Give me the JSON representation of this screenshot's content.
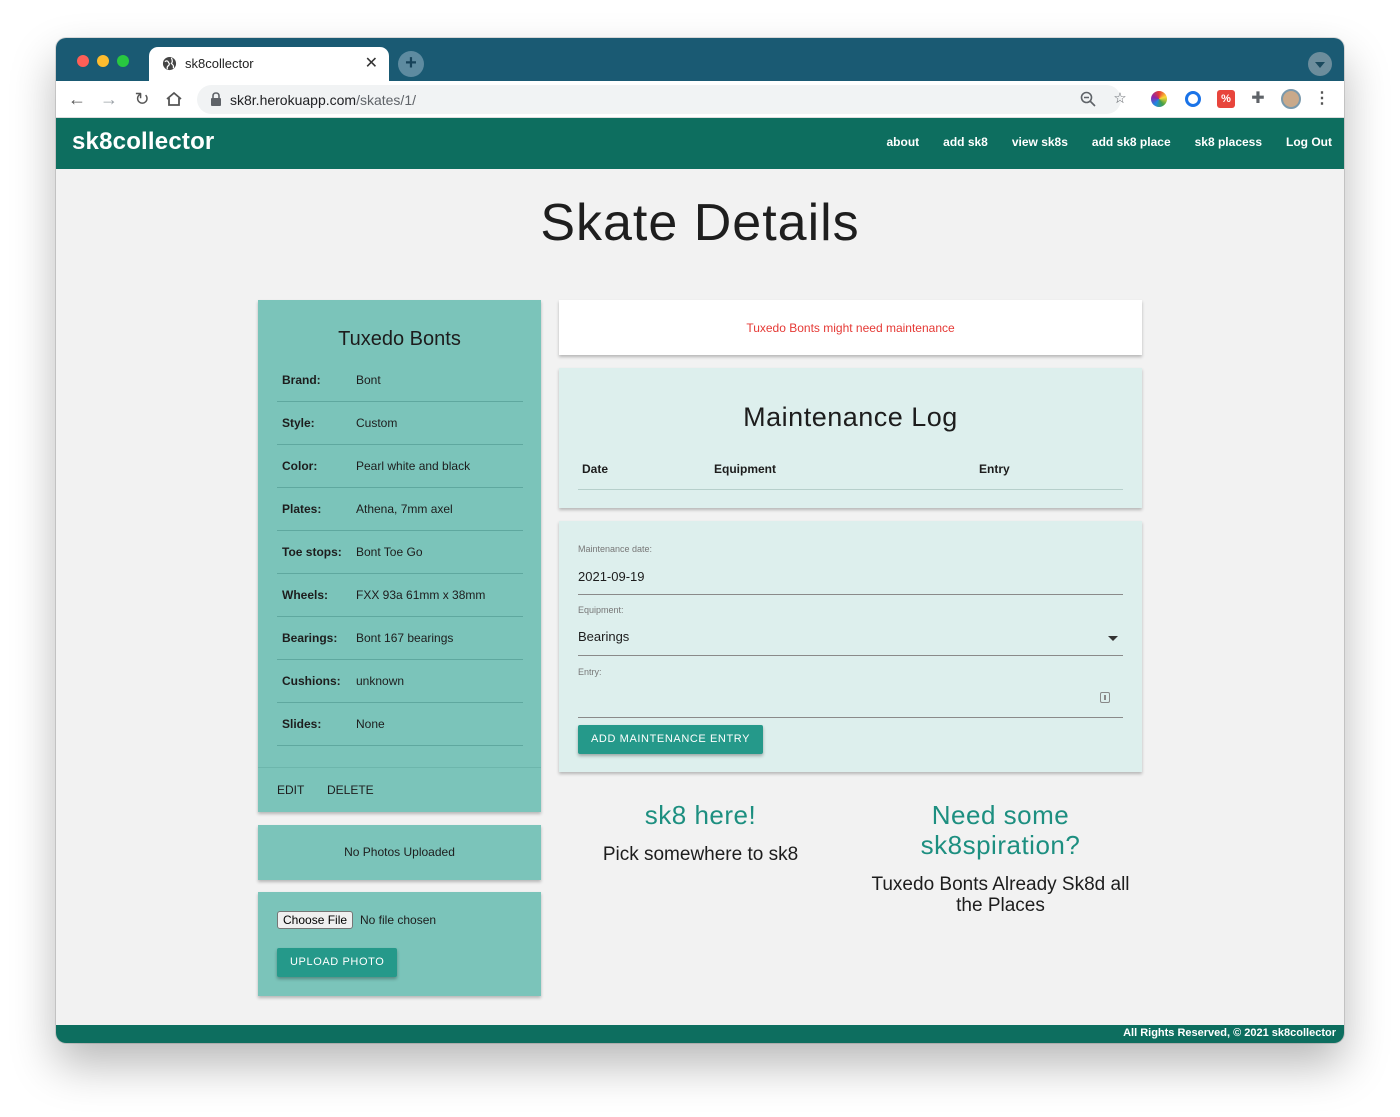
{
  "browser": {
    "tab_title": "sk8collector",
    "url_host": "sk8r.herokuapp.com",
    "url_path": "/skates/1/"
  },
  "navbar": {
    "brand": "sk8collector",
    "links": [
      "about",
      "add sk8",
      "view sk8s",
      "add sk8 place",
      "sk8 placess",
      "Log Out"
    ]
  },
  "page": {
    "title": "Skate Details"
  },
  "skate": {
    "name": "Tuxedo Bonts",
    "specs": [
      {
        "label": "Brand:",
        "value": "Bont"
      },
      {
        "label": "Style:",
        "value": "Custom"
      },
      {
        "label": "Color:",
        "value": "Pearl white and black"
      },
      {
        "label": "Plates:",
        "value": "Athena, 7mm axel"
      },
      {
        "label": "Toe stops:",
        "value": "Bont Toe Go"
      },
      {
        "label": "Wheels:",
        "value": "FXX 93a 61mm x 38mm"
      },
      {
        "label": "Bearings:",
        "value": "Bont 167 bearings"
      },
      {
        "label": "Cushions:",
        "value": "unknown"
      },
      {
        "label": "Slides:",
        "value": "None"
      }
    ],
    "edit_label": "EDIT",
    "delete_label": "DELETE"
  },
  "photos": {
    "empty_text": "No Photos Uploaded",
    "choose_file_label": "Choose File",
    "no_file_text": "No file chosen",
    "upload_label": "UPLOAD PHOTO"
  },
  "alert": {
    "text": "Tuxedo Bonts might need maintenance"
  },
  "maintenance_log": {
    "title": "Maintenance Log",
    "columns": [
      "Date",
      "Equipment",
      "Entry"
    ]
  },
  "maintenance_form": {
    "date_label": "Maintenance date:",
    "date_value": "2021-09-19",
    "equipment_label": "Equipment:",
    "equipment_value": "Bearings",
    "entry_label": "Entry:",
    "submit_label": "ADD MAINTENANCE ENTRY"
  },
  "sk8_here": {
    "heading": "sk8 here!",
    "sub": "Pick somewhere to sk8"
  },
  "inspiration": {
    "heading_line1": "Need some",
    "heading_line2": "sk8spiration?",
    "sub": "Tuxedo Bonts Already Sk8d all the Places"
  },
  "footer": {
    "text": "All Rights Reserved, © 2021 sk8collector"
  },
  "colors": {
    "navbar": "#0d6e5f",
    "tab_strip": "#1a5a73",
    "card_teal": "#7bc4ba",
    "card_mint": "#ddefed",
    "button": "#25998a",
    "alert_text": "#e53935",
    "accent_heading": "#1d8f80"
  }
}
